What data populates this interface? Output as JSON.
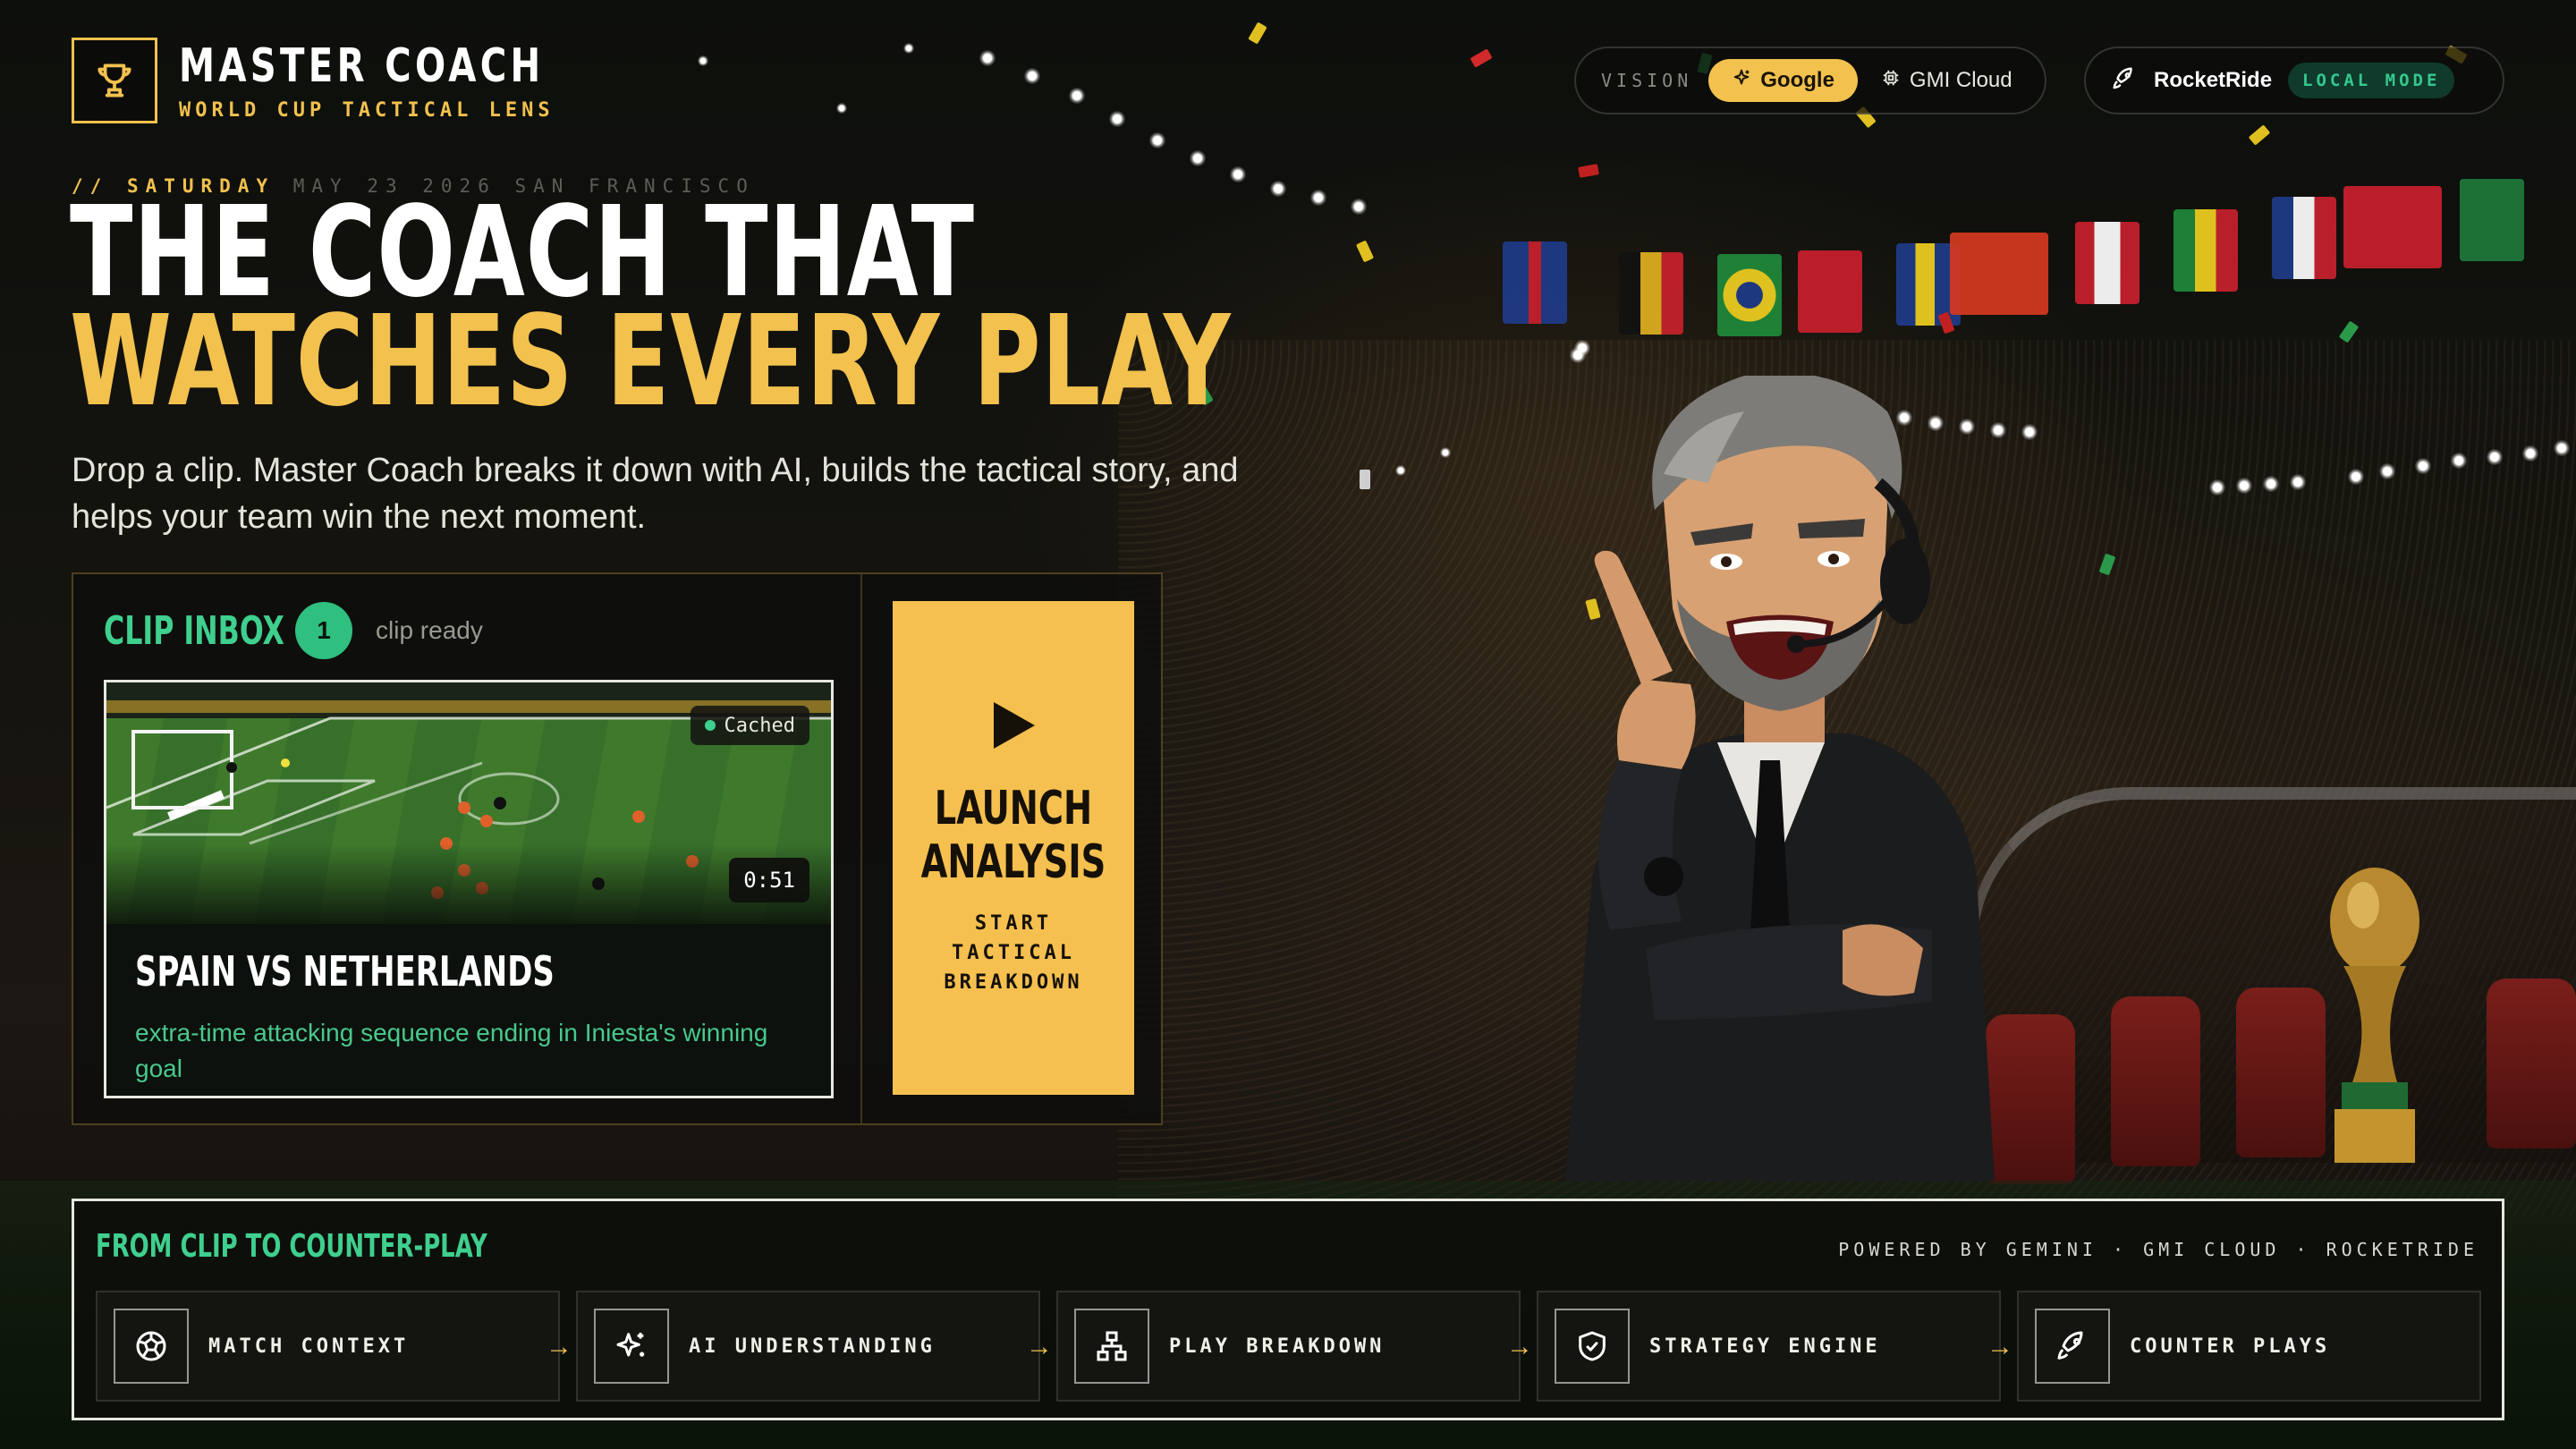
{
  "brand": {
    "title": "MASTER COACH",
    "subtitle": "WORLD CUP TACTICAL LENS",
    "icon": "trophy-icon"
  },
  "vision": {
    "label": "VISION",
    "options": [
      {
        "label": "Google",
        "icon": "sparkle-icon",
        "selected": true
      },
      {
        "label": "GMI Cloud",
        "icon": "chip-icon",
        "selected": false
      }
    ]
  },
  "runtime": {
    "name": "RocketRide",
    "icon": "rocket-icon",
    "mode": "LOCAL MODE"
  },
  "hero": {
    "dateline_prefix": "//",
    "day": "SATURDAY",
    "date_rest": "MAY 23 2026 SAN FRANCISCO",
    "headline_line1": "THE COACH THAT",
    "headline_line2": "WATCHES EVERY PLAY",
    "lede": "Drop a clip. Master Coach breaks it down with AI, builds the tactical story, and helps your team win the next moment."
  },
  "inbox": {
    "title": "CLIP INBOX",
    "count": "1",
    "count_label": "clip ready",
    "clip": {
      "status": "Cached",
      "duration": "0:51",
      "title": "SPAIN VS NETHERLANDS",
      "description": "extra-time attacking sequence ending in Iniesta's winning goal"
    }
  },
  "launch": {
    "title_line1": "LAUNCH",
    "title_line2": "ANALYSIS",
    "sub": "START TACTICAL BREAKDOWN",
    "icon": "play-icon"
  },
  "pipeline": {
    "title": "FROM CLIP TO COUNTER-PLAY",
    "powered_by": "POWERED BY GEMINI · GMI CLOUD · ROCKETRIDE",
    "steps": [
      {
        "label": "MATCH CONTEXT",
        "icon": "football-icon"
      },
      {
        "label": "AI UNDERSTANDING",
        "icon": "sparkles-icon"
      },
      {
        "label": "PLAY BREAKDOWN",
        "icon": "hierarchy-icon"
      },
      {
        "label": "STRATEGY ENGINE",
        "icon": "shield-icon"
      },
      {
        "label": "COUNTER PLAYS",
        "icon": "rocket-icon"
      }
    ]
  },
  "colors": {
    "accent_gold": "#f2c14e",
    "accent_green": "#3fcf8e",
    "background": "#0b0c0a"
  }
}
